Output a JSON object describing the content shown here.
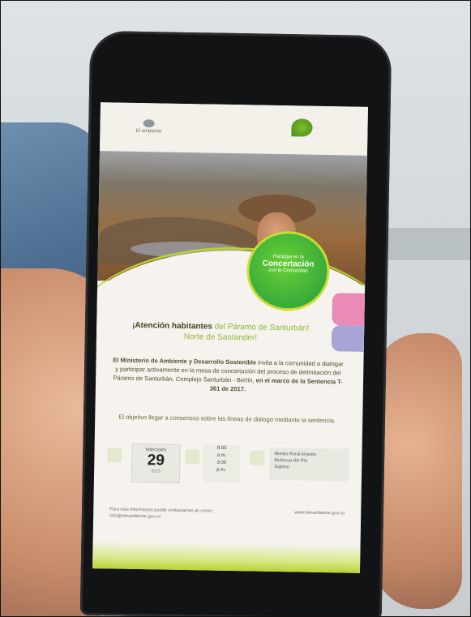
{
  "poster": {
    "logo_left": "El ambiente",
    "badge": {
      "line1": "Participa en la",
      "line2": "Concertación",
      "line3": "con la Comunidad"
    },
    "title_prefix": "¡Atención habitantes",
    "title_suffix": "del Páramo de Santurbán!",
    "title_line2": "Norte de Santander!",
    "body_lead": "El Ministerio de Ambiente y Desarrollo Sostenible",
    "body_rest": "invita a la comunidad a dialogar y participar activamente en la mesa de concertación del proceso de delimitación del Páramo de Santurbán, Complejo Santurbán - Berlín,",
    "body_end": "en el marco de la Sentencia T-361 de 2017.",
    "sub": "El objetivo llegar a consensos sobre las líneas de diálogo mediante la sentencia.",
    "date": {
      "month": "Miércoles",
      "day": "29",
      "year": "2023"
    },
    "time": {
      "start": "8:00",
      "start_period": "a.m.",
      "end": "3:00",
      "end_period": "p.m."
    },
    "place": {
      "line1": "Mundo Rural Arguelo",
      "line2": "Mutiscua del Río",
      "line3": "Sujetos"
    },
    "footer_left": "Para más información puede contactarnos al correo: info@minambiente.gov.co",
    "footer_right": "www.minambiente.gov.co"
  }
}
